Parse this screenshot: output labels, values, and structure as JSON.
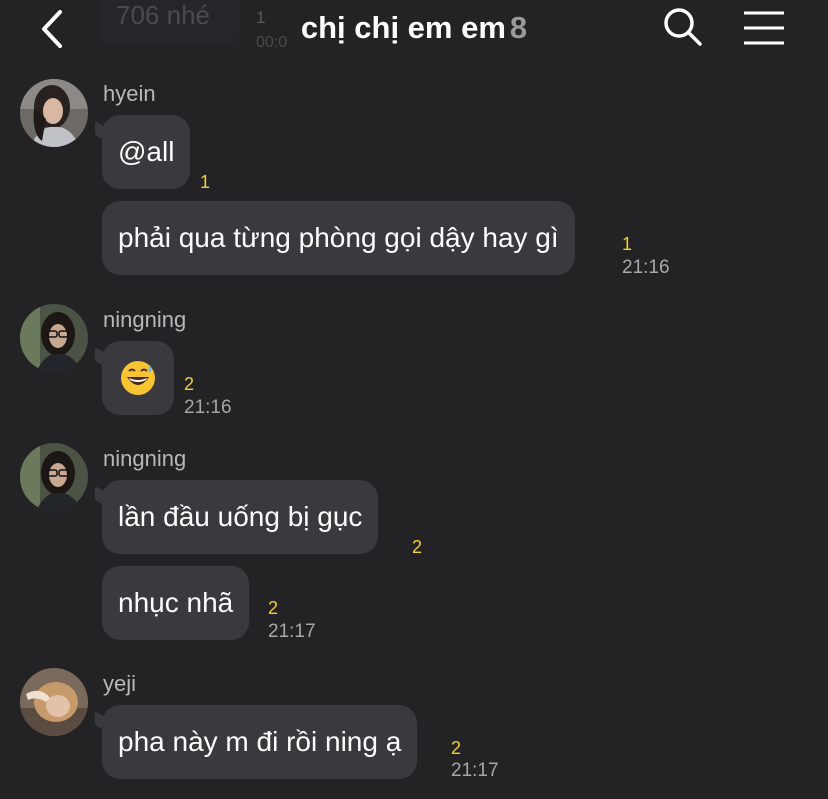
{
  "header": {
    "title": "chị chị em em",
    "member_count": "8",
    "ghost_message": "706 nhé",
    "ghost_count": "1",
    "ghost_time": "00:0"
  },
  "messages": [
    {
      "sender": "hyein",
      "text": "@all",
      "unread": "1"
    },
    {
      "text": "phải qua từng phòng gọi dậy hay gì",
      "unread": "1",
      "time": "21:16"
    },
    {
      "sender": "ningning",
      "text": "😅",
      "unread": "2",
      "time": "21:16"
    },
    {
      "sender": "ningning",
      "text": "lần đầu uống bị gục",
      "unread": "2"
    },
    {
      "text": "nhục nhã",
      "unread": "2",
      "time": "21:17"
    },
    {
      "sender": "yeji",
      "text": "pha này m đi rồi ning ạ",
      "unread": "2",
      "time": "21:17"
    }
  ],
  "colors": {
    "background": "#232326",
    "bubble": "#3a3a3e",
    "unread": "#f2d12b",
    "time": "#a7a7aa"
  },
  "icons": {
    "back": "chevron-left-icon",
    "search": "search-icon",
    "menu": "hamburger-menu-icon",
    "emoji": "grinning-sweat-emoji"
  }
}
